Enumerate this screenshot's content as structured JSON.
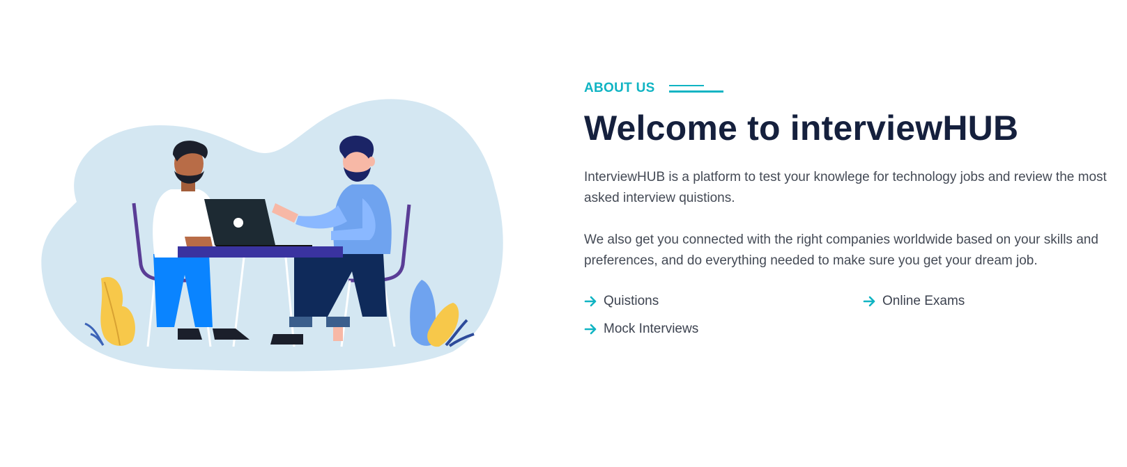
{
  "about": {
    "eyebrow": "ABOUT US",
    "title": "Welcome to interviewHUB",
    "paragraphs": [
      "InterviewHUB is a platform to test your knowlege for technology jobs and review the most asked interview quistions.",
      "We also get you connected with the right companies worldwide based on your skills and preferences, and do everything needed to make sure you get your dream job."
    ],
    "features": [
      {
        "label": "Quistions",
        "icon": "arrow-right-icon"
      },
      {
        "label": "Online Exams",
        "icon": "arrow-right-icon"
      },
      {
        "label": "Mock Interviews",
        "icon": "arrow-right-icon"
      }
    ]
  },
  "illustration": {
    "subject": "two-people-meeting-at-laptop"
  },
  "colors": {
    "accent": "#10b4c3",
    "title": "#15203d",
    "body_text": "#444a55",
    "blob": "#d4e7f2"
  }
}
